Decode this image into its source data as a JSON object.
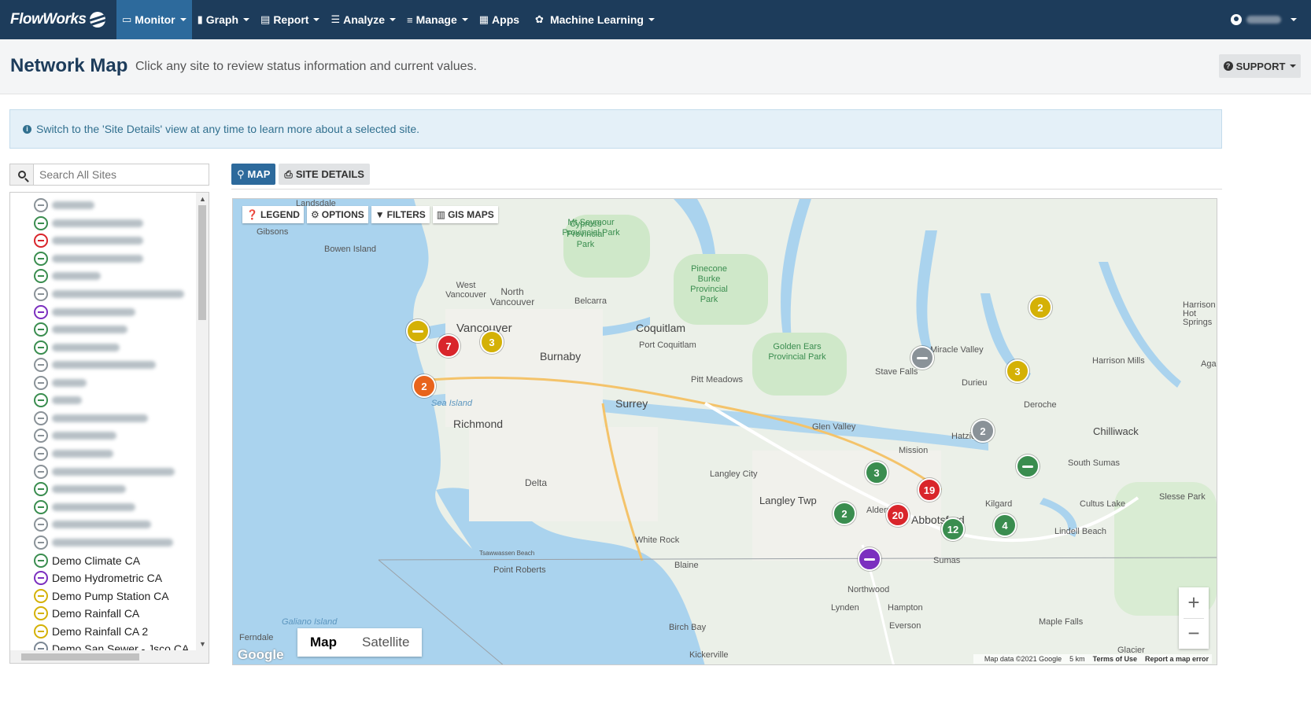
{
  "brand": "FlowWorks",
  "nav": [
    {
      "label": "Monitor",
      "icon": "monitor-icon",
      "glyph": "▭",
      "active": true
    },
    {
      "label": "Graph",
      "icon": "bar-chart-icon",
      "glyph": "▮",
      "active": false
    },
    {
      "label": "Report",
      "icon": "report-icon",
      "glyph": "▤",
      "active": false
    },
    {
      "label": "Analyze",
      "icon": "list-icon",
      "glyph": "☰",
      "active": false
    },
    {
      "label": "Manage",
      "icon": "sliders-icon",
      "glyph": "≡",
      "active": false
    },
    {
      "label": "Apps",
      "icon": "grid-icon",
      "glyph": "▦",
      "active": false
    },
    {
      "label": "Machine Learning",
      "icon": "brain-icon",
      "glyph": "✿",
      "active": false
    }
  ],
  "header": {
    "title": "Network Map",
    "subtitle": "Click any site to review status information and current values.",
    "support_label": "SUPPORT"
  },
  "info": {
    "text": "Switch to the 'Site Details' view at any time to learn more about a selected site."
  },
  "search": {
    "placeholder": "Search All Sites"
  },
  "site_list": [
    {
      "label": "Demo Climate CA",
      "color": "#3a8d4f"
    },
    {
      "label": "Demo Hydrometric CA",
      "color": "#7b2fbf"
    },
    {
      "label": "Demo Pump Station CA",
      "color": "#d4b106"
    },
    {
      "label": "Demo Rainfall CA",
      "color": "#d4b106"
    },
    {
      "label": "Demo Rainfall CA 2",
      "color": "#d4b106"
    },
    {
      "label": "Demo San Sewer - Jsco CA",
      "color": "#7b8794"
    }
  ],
  "tabs": {
    "map": "MAP",
    "details": "SITE DETAILS"
  },
  "map_controls": {
    "legend": "LEGEND",
    "options": "OPTIONS",
    "filters": "FILTERS",
    "gis": "GIS MAPS"
  },
  "map_type": {
    "map": "Map",
    "satellite": "Satellite"
  },
  "attribution": {
    "data": "Map data ©2021 Google",
    "scale": "5 km",
    "terms": "Terms of Use",
    "report": "Report a map error"
  },
  "google": "Google",
  "zoom": {
    "plus": "+",
    "minus": "−"
  },
  "colors": {
    "green": "#3a8d4f",
    "red": "#d9252b",
    "yellow": "#d4b106",
    "orange": "#e8641c",
    "gray": "#8a9298",
    "purple": "#7b2fbf",
    "nav": "#1d3c5b",
    "accent": "#2d6a9c"
  },
  "clusters": [
    {
      "count": "7",
      "color": "red"
    },
    {
      "count": "3",
      "color": "yellow"
    },
    {
      "count": "2",
      "color": "orange"
    },
    {
      "count": "2",
      "color": "yellow"
    },
    {
      "count": "3",
      "color": "yellow"
    },
    {
      "count": "2",
      "color": "gray"
    },
    {
      "count": "3",
      "color": "green"
    },
    {
      "count": "19",
      "color": "red"
    },
    {
      "count": "2",
      "color": "green"
    },
    {
      "count": "20",
      "color": "red"
    },
    {
      "count": "12",
      "color": "green"
    },
    {
      "count": "4",
      "color": "green"
    }
  ],
  "map_labels": [
    "Landsdale",
    "Gibsons",
    "Bowen Island",
    "West Vancouver",
    "North Vancouver",
    "Vancouver",
    "Burnaby",
    "Belcarra",
    "Coquitlam",
    "Port Coquitlam",
    "Pitt Meadows",
    "Surrey",
    "Richmond",
    "Delta",
    "Langley City",
    "Langley Twp",
    "Abbotsford",
    "White Rock",
    "Blaine",
    "Point Roberts",
    "Tsawwassen Beach",
    "Mission",
    "Hatzic",
    "Stave Falls",
    "Miracle Valley",
    "Durieu",
    "Deroche",
    "Harrison Mills",
    "Chilliwack",
    "South Sumas",
    "Kilgard",
    "Sumas",
    "Cultus Lake",
    "Slesse Park",
    "Lindell Beach",
    "Northwood",
    "Lynden",
    "Hampton",
    "Everson",
    "Maple Falls",
    "Birch Bay",
    "Kickerville",
    "Ferndale",
    "Glen Valley",
    "Aldergrove",
    "Sea Island",
    "Galiano Island",
    "Glacier",
    "Agassiz",
    "Harrison Hot Springs"
  ],
  "parks": [
    "Mt Seymour Provincial Park",
    "Pinecone Burke Provincial Park",
    "Golden Ears Provincial Park",
    "Cypress Provincial Park"
  ]
}
